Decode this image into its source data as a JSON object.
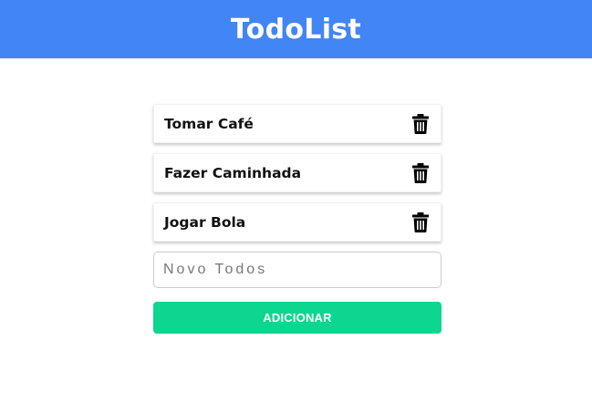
{
  "header": {
    "title": "TodoList",
    "background": "#4285f4"
  },
  "todos": [
    {
      "text": "Tomar Café",
      "icon": "trash-icon"
    },
    {
      "text": "Fazer Caminhada",
      "icon": "trash-icon"
    },
    {
      "text": "Jogar Bola",
      "icon": "trash-icon"
    }
  ],
  "new_todo": {
    "placeholder": "Novo Todos",
    "value": ""
  },
  "add_button": {
    "label": "ADICIONAR",
    "color": "#0cd68f"
  }
}
